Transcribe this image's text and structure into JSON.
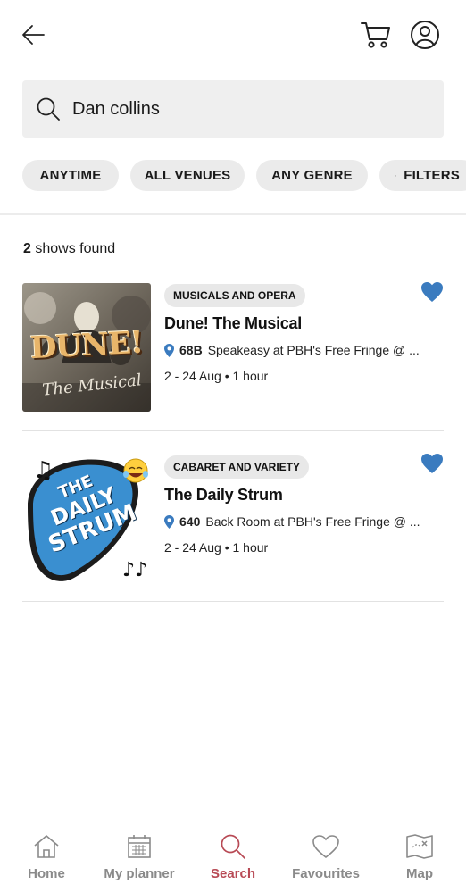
{
  "header": {
    "back_icon": "back-arrow-icon",
    "cart_icon": "cart-icon",
    "account_icon": "account-icon"
  },
  "search": {
    "value": "Dan collins",
    "icon": "search-icon"
  },
  "filters": {
    "chips": [
      {
        "label": "ANYTIME"
      },
      {
        "label": "ALL VENUES"
      },
      {
        "label": "ANY GENRE"
      },
      {
        "label": "FILTERS",
        "icon": "filter-lines-icon"
      }
    ]
  },
  "results": {
    "count": "2",
    "count_suffix": " shows found"
  },
  "shows": [
    {
      "genre": "MUSICALS AND OPERA",
      "title": "Dune! The Musical",
      "venue_number": "68B",
      "venue_name": "Speakeasy at PBH's Free Fringe @ ...",
      "dates": "2 - 24 Aug • 1 hour",
      "favourited": true,
      "thumb_text_main": "DUNE!",
      "thumb_text_sub": "The Musical"
    },
    {
      "genre": "CABARET AND VARIETY",
      "title": "The Daily Strum",
      "venue_number": "640",
      "venue_name": "Back Room at PBH's Free Fringe @ ...",
      "dates": "2 - 24 Aug • 1 hour",
      "favourited": true,
      "thumb_text_1": "THE",
      "thumb_text_2": "DAILY",
      "thumb_text_3": "STRUM"
    }
  ],
  "bottom_nav": {
    "items": [
      {
        "label": "Home",
        "icon": "home-icon"
      },
      {
        "label": "My planner",
        "icon": "calendar-icon"
      },
      {
        "label": "Search",
        "icon": "search-icon",
        "active": true
      },
      {
        "label": "Favourites",
        "icon": "heart-icon"
      },
      {
        "label": "Map",
        "icon": "map-icon"
      }
    ]
  },
  "colors": {
    "accent": "#b84a55",
    "favourite": "#3a7bbf",
    "chip_bg": "#ebebeb",
    "search_bg": "#efefef"
  }
}
